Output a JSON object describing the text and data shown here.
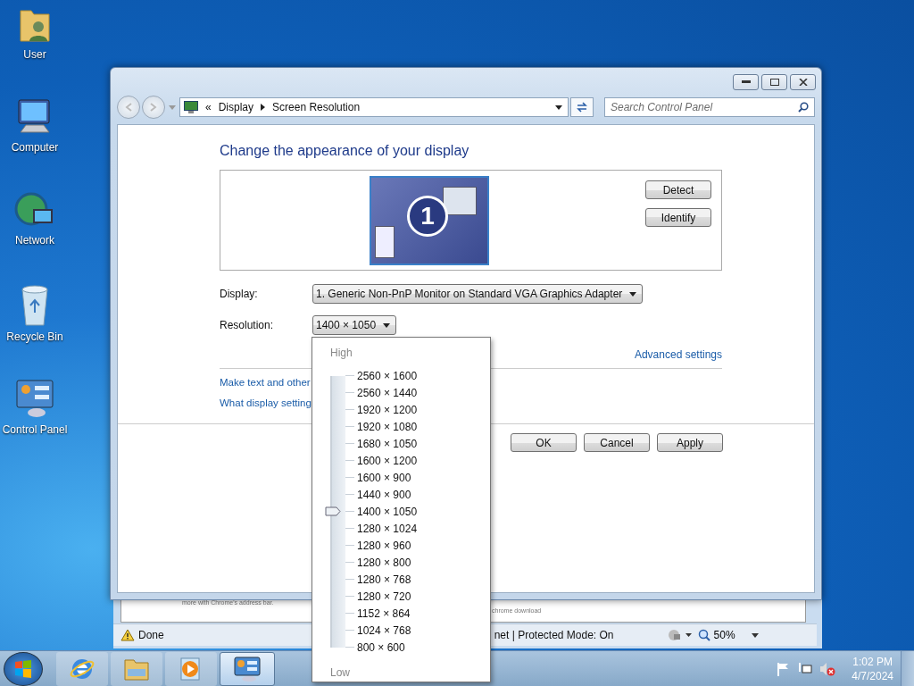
{
  "desktop_icons": [
    {
      "kind": "user",
      "label": "User"
    },
    {
      "kind": "computer",
      "label": "Computer"
    },
    {
      "kind": "network",
      "label": "Network"
    },
    {
      "kind": "recycle",
      "label": "Recycle Bin"
    },
    {
      "kind": "control",
      "label": "Control Panel"
    }
  ],
  "background_window": {
    "page_texts": [
      "more with Chrome's address bar.",
      "chrome download"
    ],
    "status": "Done",
    "zone": "net | Protected Mode: On",
    "zoom": "50%"
  },
  "window": {
    "breadcrumb_prefix": "«",
    "breadcrumb": [
      "Display",
      "Screen Resolution"
    ],
    "search": {
      "placeholder": "Search Control Panel"
    },
    "heading": "Change the appearance of your display",
    "monitor_number": "1",
    "side_buttons": [
      "Detect",
      "Identify"
    ],
    "display_label": "Display:",
    "display_value": "1. Generic Non-PnP Monitor on Standard VGA Graphics Adapter",
    "resolution_label": "Resolution:",
    "resolution_value": "1400 × 1050",
    "advanced_link": "Advanced settings",
    "links": [
      "Make text and other",
      "What display setting"
    ],
    "buttons": [
      "OK",
      "Cancel",
      "Apply"
    ]
  },
  "resolution_menu": {
    "high": "High",
    "low": "Low",
    "options": [
      {
        "label": "2560 × 1600",
        "selected": false
      },
      {
        "label": "2560 × 1440",
        "selected": false
      },
      {
        "label": "1920 × 1200",
        "selected": false
      },
      {
        "label": "1920 × 1080",
        "selected": false
      },
      {
        "label": "1680 × 1050",
        "selected": false
      },
      {
        "label": "1600 × 1200",
        "selected": false
      },
      {
        "label": "1600 × 900",
        "selected": false
      },
      {
        "label": "1440 × 900",
        "selected": false
      },
      {
        "label": "1400 × 1050",
        "selected": true
      },
      {
        "label": "1280 × 1024",
        "selected": false
      },
      {
        "label": "1280 × 960",
        "selected": false
      },
      {
        "label": "1280 × 800",
        "selected": false
      },
      {
        "label": "1280 × 768",
        "selected": false
      },
      {
        "label": "1280 × 720",
        "selected": false
      },
      {
        "label": "1152 × 864",
        "selected": false
      },
      {
        "label": "1024 × 768",
        "selected": false
      },
      {
        "label": "800 × 600",
        "selected": false
      }
    ]
  },
  "taskbar": {
    "apps": [
      {
        "kind": "browser",
        "active": false
      },
      {
        "kind": "folder",
        "active": false
      },
      {
        "kind": "media",
        "active": false
      },
      {
        "kind": "control",
        "active": true
      }
    ],
    "time": "1:02 PM",
    "date": "4/7/2024"
  }
}
